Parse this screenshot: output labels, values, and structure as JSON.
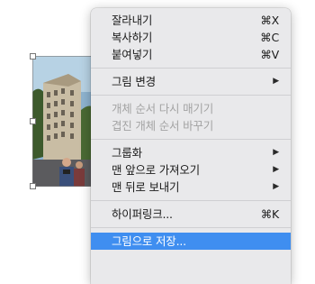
{
  "menu": {
    "groups": [
      [
        {
          "label": "잘라내기",
          "shortcut": "⌘X"
        },
        {
          "label": "복사하기",
          "shortcut": "⌘C"
        },
        {
          "label": "붙여넣기",
          "shortcut": "⌘V"
        }
      ],
      [
        {
          "label": "그림 변경",
          "arrow": "▶"
        }
      ],
      [
        {
          "label": "개체 순서 다시 매기기",
          "disabled": true
        },
        {
          "label": "겹진 개체 순서 바꾸기",
          "disabled": true
        }
      ],
      [
        {
          "label": "그룹화",
          "arrow": "▶"
        },
        {
          "label": "맨 앞으로 가져오기",
          "arrow": "▶"
        },
        {
          "label": "맨 뒤로 보내기",
          "arrow": "▶"
        }
      ],
      [
        {
          "label": "하이퍼링크...",
          "shortcut": "⌘K"
        }
      ],
      [
        {
          "label": "그림으로 저장...",
          "highlighted": true
        }
      ]
    ]
  },
  "highlight_color": "#3f8ef0"
}
